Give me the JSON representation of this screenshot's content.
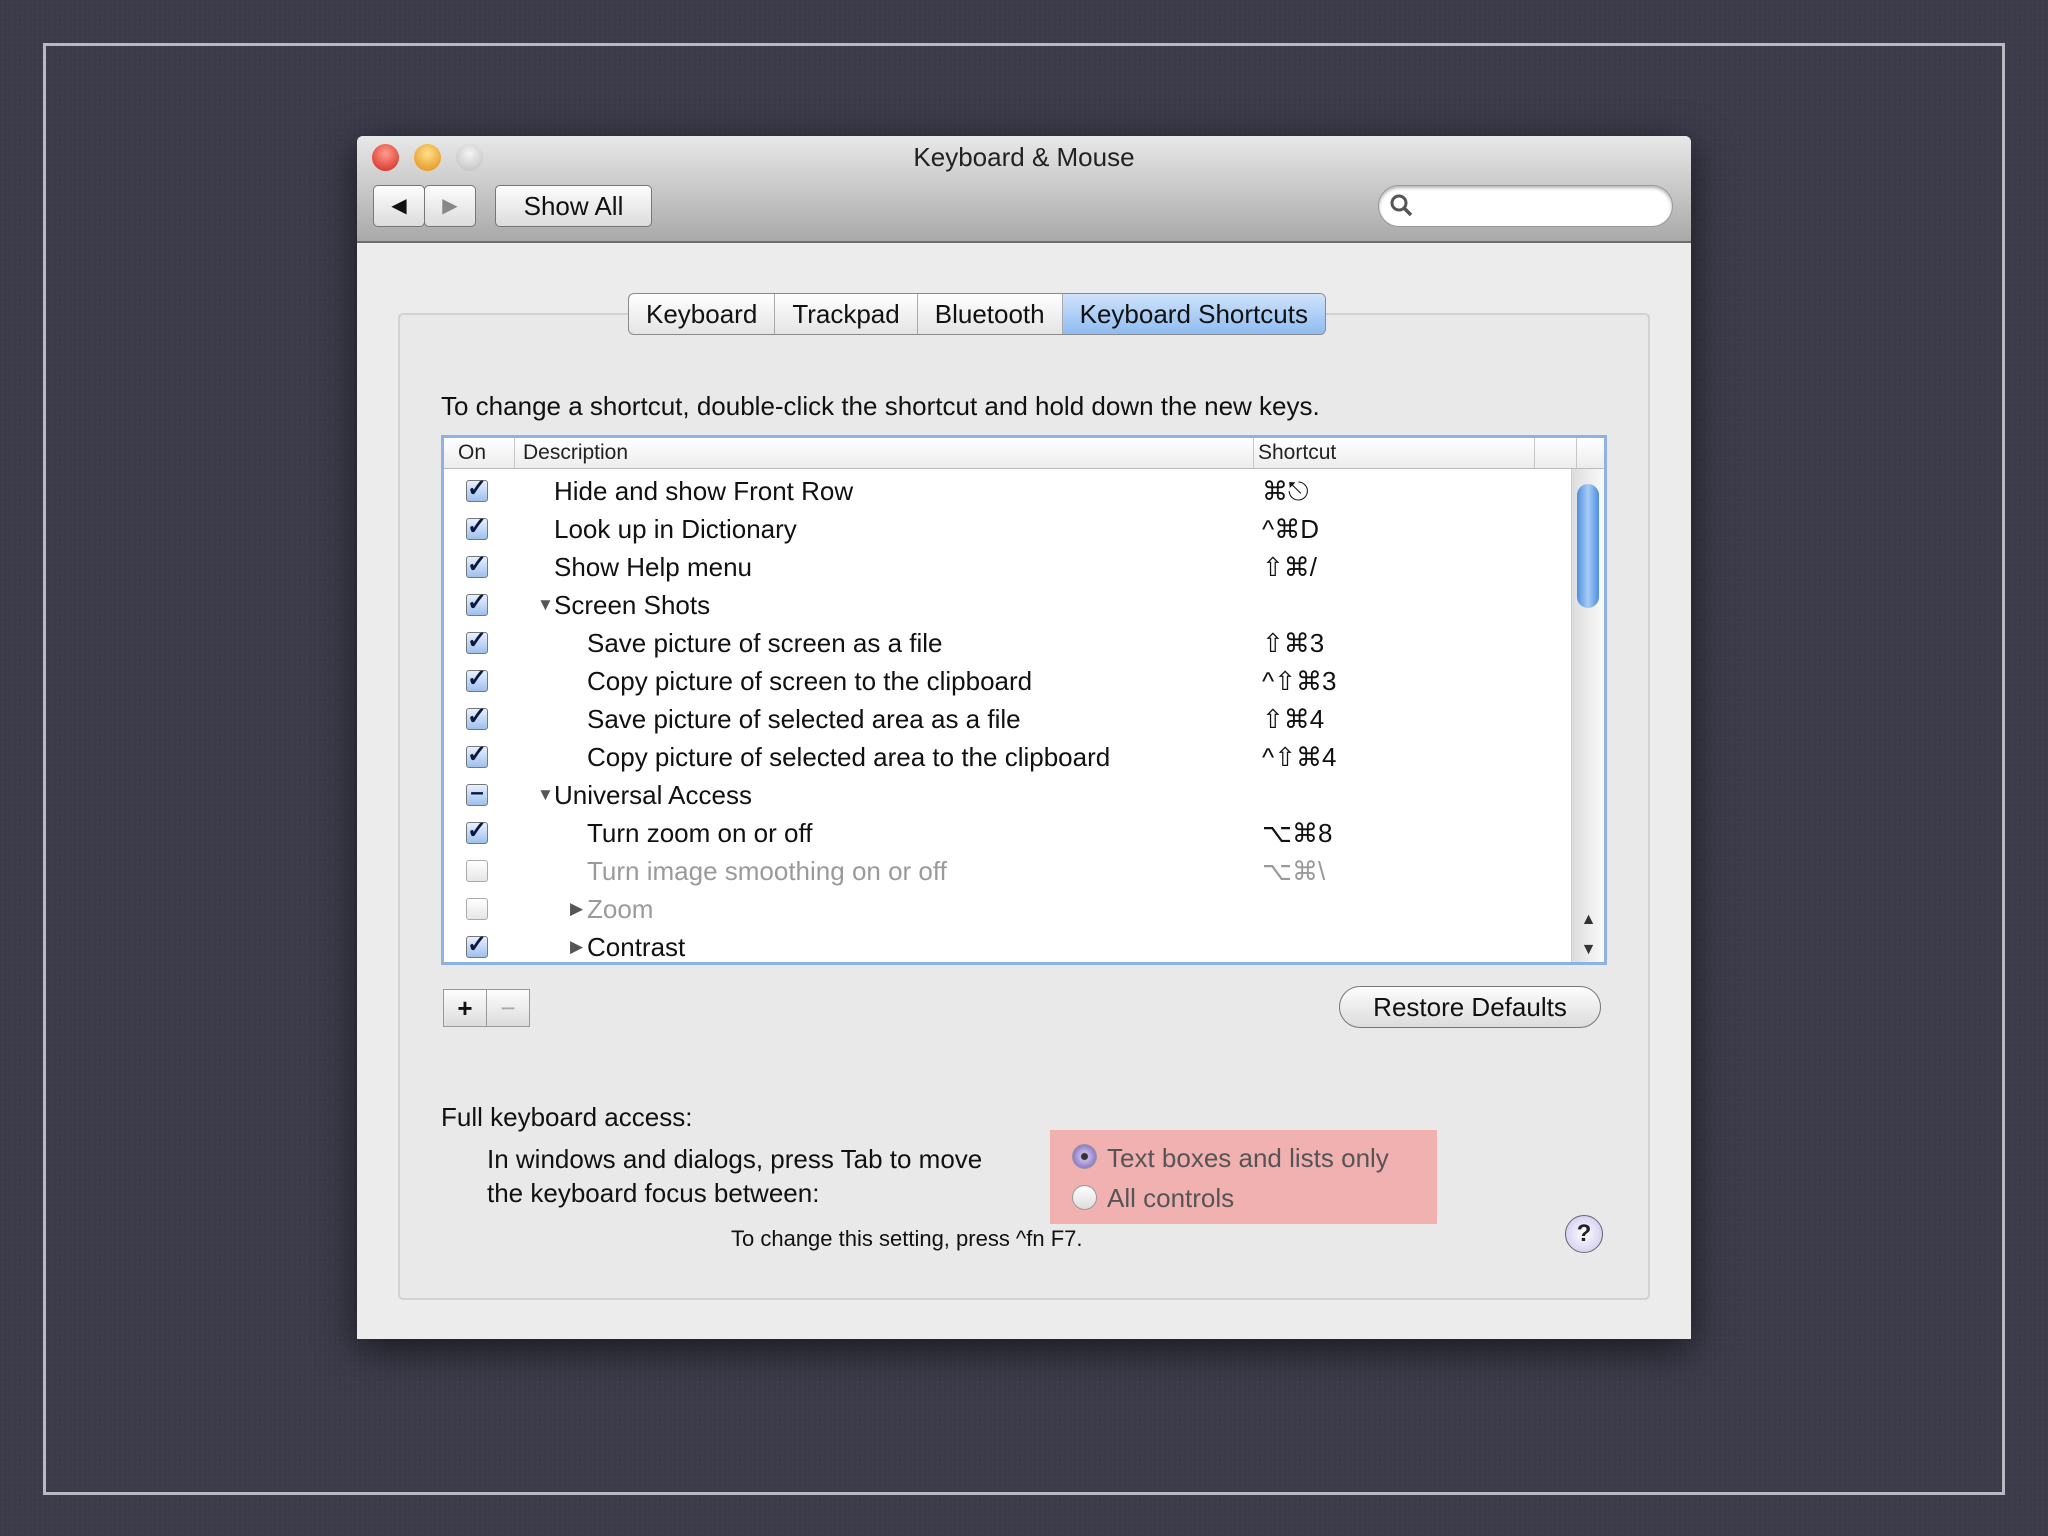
{
  "window": {
    "title": "Keyboard & Mouse"
  },
  "toolbar": {
    "back_icon": "◀",
    "forward_icon": "▶",
    "show_all": "Show All",
    "search_placeholder": ""
  },
  "tabs": [
    {
      "label": "Keyboard"
    },
    {
      "label": "Trackpad"
    },
    {
      "label": "Bluetooth"
    },
    {
      "label": "Keyboard Shortcuts",
      "selected": true
    }
  ],
  "instruction": "To change a shortcut, double-click the shortcut and hold down the new keys.",
  "table": {
    "headers": {
      "on": "On",
      "description": "Description",
      "shortcut": "Shortcut"
    },
    "rows": [
      {
        "state": "on",
        "level": 0,
        "disclosure": "",
        "desc": "Hide and show Front Row",
        "shortcut": "⌘⎋"
      },
      {
        "state": "on",
        "level": 0,
        "disclosure": "",
        "desc": "Look up in Dictionary",
        "shortcut": "^⌘D"
      },
      {
        "state": "on",
        "level": 0,
        "disclosure": "",
        "desc": "Show Help menu",
        "shortcut": "⇧⌘/"
      },
      {
        "state": "on",
        "level": 0,
        "disclosure": "open",
        "desc": "Screen Shots",
        "shortcut": ""
      },
      {
        "state": "on",
        "level": 1,
        "disclosure": "",
        "desc": "Save picture of screen as a file",
        "shortcut": "⇧⌘3"
      },
      {
        "state": "on",
        "level": 1,
        "disclosure": "",
        "desc": "Copy picture of screen to the clipboard",
        "shortcut": "^⇧⌘3"
      },
      {
        "state": "on",
        "level": 1,
        "disclosure": "",
        "desc": "Save picture of selected area as a file",
        "shortcut": "⇧⌘4"
      },
      {
        "state": "on",
        "level": 1,
        "disclosure": "",
        "desc": "Copy picture of selected area to the clipboard",
        "shortcut": "^⇧⌘4"
      },
      {
        "state": "mixed",
        "level": 0,
        "disclosure": "open",
        "desc": "Universal Access",
        "shortcut": ""
      },
      {
        "state": "on",
        "level": 1,
        "disclosure": "",
        "desc": "Turn zoom on or off",
        "shortcut": "⌥⌘8"
      },
      {
        "state": "off",
        "level": 1,
        "disclosure": "",
        "desc": "Turn image smoothing on or off",
        "shortcut": "⌥⌘\\",
        "disabled": true
      },
      {
        "state": "off",
        "level": 1,
        "disclosure": "closed",
        "desc": "Zoom",
        "shortcut": "",
        "disabled": true
      },
      {
        "state": "on",
        "level": 1,
        "disclosure": "closed",
        "desc": "Contrast",
        "shortcut": ""
      }
    ]
  },
  "buttons": {
    "add": "+",
    "remove": "−",
    "restore": "Restore Defaults"
  },
  "fka": {
    "label": "Full keyboard access:",
    "line1": "In windows and dialogs, press Tab to move",
    "line2": "the keyboard focus between:",
    "options": [
      {
        "label": "Text boxes and lists only",
        "selected": true
      },
      {
        "label": "All controls",
        "selected": false
      }
    ],
    "note": "To change this setting, press ^fn F7.",
    "help": "?"
  },
  "colors": {
    "highlight": "#f2b1b1",
    "accent": "#8fbcf2"
  }
}
